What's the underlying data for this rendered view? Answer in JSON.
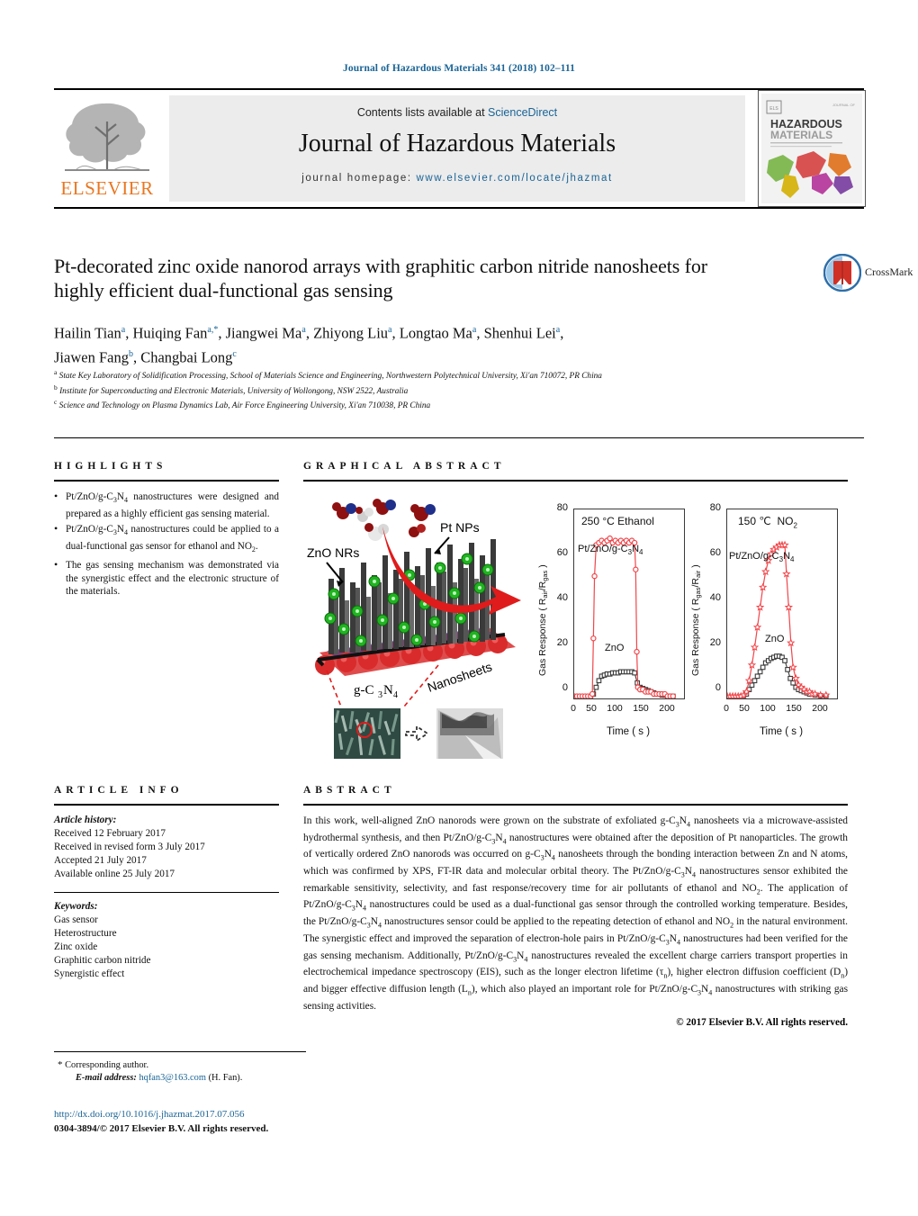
{
  "runhead": "Journal of Hazardous Materials 341 (2018) 102–111",
  "masthead": {
    "contents_prefix": "Contents lists available at ",
    "sciencedirect": "ScienceDirect",
    "journal_title": "Journal of Hazardous Materials",
    "homepage_prefix": "journal homepage: ",
    "homepage_url": "www.elsevier.com/locate/jhazmat",
    "publisher": "ELSEVIER",
    "cover_line1": "HAZARDOUS",
    "cover_line2": "MATERIALS"
  },
  "article": {
    "title": "Pt-decorated zinc oxide nanorod arrays with graphitic carbon nitride nanosheets for highly efficient dual-functional gas sensing",
    "crossmark_label": "CrossMark",
    "authors_line1": "Hailin Tian<sup>a</sup>, Huiqing Fan<sup>a,*</sup>, Jiangwei Ma<sup>a</sup>, Zhiyong Liu<sup>a</sup>, Longtao Ma<sup>a</sup>, Shenhui Lei<sup>a</sup>,",
    "authors_line2": "Jiawen Fang<sup>b</sup>, Changbai Long<sup>c</sup>",
    "affiliations": [
      "<sup>a</sup> State Key Laboratory of Solidification Processing, School of Materials Science and Engineering, Northwestern Polytechnical University, Xi'an 710072, PR China",
      "<sup>b</sup> Institute for Superconducting and Electronic Materials, University of Wollongong, NSW 2522, Australia",
      "<sup>c</sup> Science and Technology on Plasma Dynamics Lab, Air Force Engineering University, Xi'an 710038, PR China"
    ]
  },
  "highlights": {
    "heading": "HIGHLIGHTS",
    "items": [
      "Pt/ZnO/g-C<sub>3</sub>N<sub>4</sub> nanostructures were designed and prepared as a highly efficient gas sensing material.",
      "Pt/ZnO/g-C<sub>3</sub>N<sub>4</sub> nanostructures could be applied to a dual-functional gas sensor for ethanol and NO<sub>2</sub>.",
      "The gas sensing mechanism was demonstrated via the synergistic effect and the electronic structure of the materials."
    ]
  },
  "graphical_abstract": {
    "heading": "GRAPHICAL ABSTRACT",
    "schematic_labels": {
      "znonrs": "ZnO NRs",
      "ptnps": "Pt NPs",
      "nanosheets": "Nanosheets",
      "gc3n4": "g-C₃N₄"
    }
  },
  "article_info": {
    "heading": "ARTICLE INFO",
    "history_label": "Article history:",
    "history": [
      "Received 12 February 2017",
      "Received in revised form 3 July 2017",
      "Accepted 21 July 2017",
      "Available online 25 July 2017"
    ],
    "keywords_label": "Keywords:",
    "keywords": [
      "Gas sensor",
      "Heterostructure",
      "Zinc oxide",
      "Graphitic carbon nitride",
      "Synergistic effect"
    ]
  },
  "abstract": {
    "heading": "ABSTRACT",
    "body": "In this work, well-aligned ZnO nanorods were grown on the substrate of exfoliated g-C<sub>3</sub>N<sub>4</sub> nanosheets via a microwave-assisted hydrothermal synthesis, and then Pt/ZnO/g-C<sub>3</sub>N<sub>4</sub> nanostructures were obtained after the deposition of Pt nanoparticles. The growth of vertically ordered ZnO nanorods was occurred on g-C<sub>3</sub>N<sub>4</sub> nanosheets through the bonding interaction between Zn and N atoms, which was confirmed by XPS, FT-IR data and molecular orbital theory. The Pt/ZnO/g-C<sub>3</sub>N<sub>4</sub> nanostructures sensor exhibited the remarkable sensitivity, selectivity, and fast response/recovery time for air pollutants of ethanol and NO<sub>2</sub>. The application of Pt/ZnO/g-C<sub>3</sub>N<sub>4</sub> nanostructures could be used as a dual-functional gas sensor through the controlled working temperature. Besides, the Pt/ZnO/g-C<sub>3</sub>N<sub>4</sub> nanostructures sensor could be applied to the repeating detection of ethanol and NO<sub>2</sub> in the natural environment. The synergistic effect and improved the separation of electron-hole pairs in Pt/ZnO/g-C<sub>3</sub>N<sub>4</sub> nanostructures had been verified for the gas sensing mechanism. Additionally, Pt/ZnO/g-C<sub>3</sub>N<sub>4</sub> nanostructures revealed the excellent charge carriers transport properties in electrochemical impedance spectroscopy (EIS), such as the longer electron lifetime (&tau;<sub>n</sub>), higher electron diffusion coefficient (D<sub>n</sub>) and bigger effective diffusion length (L<sub>n</sub>), which also played an important role for Pt/ZnO/g-C<sub>3</sub>N<sub>4</sub> nanostructures with striking gas sensing activities.",
    "copyright": "© 2017 Elsevier B.V. All rights reserved."
  },
  "footer": {
    "corresponding_marker": "*",
    "corresponding_text": "Corresponding author.",
    "email_label": "E-mail address:",
    "email": "hqfan3@163.com",
    "email_suffix": "(H. Fan).",
    "doi": "http://dx.doi.org/10.1016/j.jhazmat.2017.07.056",
    "issn_line": "0304-3894/© 2017 Elsevier B.V. All rights reserved."
  },
  "colors": {
    "link": "#1a6496",
    "elsevier_orange": "#E87722",
    "series_red": "#f1464a",
    "series_dark": "#3b3b3b"
  },
  "chart_data": [
    {
      "type": "line",
      "title": "250 °C  Ethanol",
      "xlabel": "Time ( s )",
      "ylabel": "Gas Response ( Rair/Rgas )",
      "xlim": [
        0,
        200
      ],
      "ylim": [
        0,
        85
      ],
      "xticks": [
        0,
        50,
        100,
        150,
        200
      ],
      "yticks": [
        0,
        20,
        40,
        60,
        80
      ],
      "grid": false,
      "annotations": [
        "Pt/ZnO/g-C3N4",
        "ZnO"
      ],
      "series": [
        {
          "name": "Pt/ZnO/g-C3N4",
          "color": "#f1464a",
          "marker": "circle",
          "x": [
            0,
            5,
            10,
            15,
            20,
            25,
            30,
            33,
            35,
            37,
            40,
            45,
            50,
            55,
            60,
            65,
            70,
            75,
            80,
            85,
            90,
            95,
            100,
            105,
            110,
            112,
            114,
            116,
            120,
            125,
            130,
            135,
            140,
            145,
            150,
            155,
            160,
            165,
            170,
            175,
            180
          ],
          "y": [
            1,
            1,
            1,
            1,
            1,
            1,
            1,
            2,
            27,
            55,
            69,
            70,
            71,
            70,
            71,
            72,
            70,
            71,
            70,
            71,
            70,
            71,
            70,
            71,
            70,
            58,
            21,
            5,
            4,
            4,
            3,
            3,
            3,
            2,
            2,
            2,
            2,
            2,
            1,
            1,
            1
          ]
        },
        {
          "name": "ZnO",
          "color": "#3b3b3b",
          "marker": "square",
          "x": [
            0,
            5,
            10,
            15,
            20,
            25,
            30,
            35,
            40,
            45,
            50,
            55,
            60,
            65,
            70,
            75,
            80,
            85,
            90,
            95,
            100,
            105,
            110,
            115,
            120,
            125,
            130,
            135,
            140,
            145,
            150,
            155,
            160,
            165,
            170,
            175,
            180
          ],
          "y": [
            0.5,
            0.5,
            0.5,
            0.5,
            0.5,
            0.5,
            0.7,
            2,
            5,
            8,
            10,
            10.5,
            11,
            11,
            11.5,
            11.5,
            11.5,
            12,
            12,
            12,
            12,
            12,
            11.5,
            7,
            5,
            4.5,
            4,
            3.5,
            3,
            2.5,
            2,
            2,
            1.5,
            1.5,
            1,
            1,
            1
          ]
        }
      ]
    },
    {
      "type": "line",
      "title": "150 °C  NO2",
      "xlabel": "Time ( s )",
      "ylabel": "Gas Response ( Rgas/Rair )",
      "xlim": [
        0,
        200
      ],
      "ylim": [
        0,
        85
      ],
      "xticks": [
        0,
        50,
        100,
        150,
        200
      ],
      "yticks": [
        0,
        20,
        40,
        60,
        80
      ],
      "grid": false,
      "annotations": [
        "Pt/ZnO/g-C3N4",
        "ZnO"
      ],
      "series": [
        {
          "name": "Pt/ZnO/g-C3N4",
          "color": "#f1464a",
          "marker": "star",
          "x": [
            0,
            5,
            10,
            15,
            20,
            25,
            30,
            35,
            40,
            45,
            50,
            55,
            60,
            65,
            70,
            75,
            80,
            85,
            90,
            95,
            100,
            105,
            108,
            112,
            116,
            120,
            125,
            130,
            135,
            140,
            145,
            150,
            155,
            160,
            170,
            180
          ],
          "y": [
            1,
            1,
            1,
            1,
            1,
            1,
            1.5,
            3,
            8,
            15,
            23,
            32,
            41,
            50,
            57,
            62,
            65,
            67,
            68,
            69,
            69,
            69,
            56,
            41,
            25,
            14,
            9,
            6,
            5,
            4,
            3,
            3,
            2,
            2,
            1.5,
            1.5
          ]
        },
        {
          "name": "ZnO",
          "color": "#3b3b3b",
          "marker": "square",
          "x": [
            0,
            5,
            10,
            15,
            20,
            25,
            30,
            35,
            40,
            45,
            50,
            55,
            60,
            65,
            70,
            75,
            80,
            85,
            90,
            95,
            100,
            105,
            110,
            115,
            120,
            125,
            130,
            135,
            140,
            145,
            150,
            160,
            170,
            180
          ],
          "y": [
            0.5,
            0.5,
            0.5,
            0.5,
            0.5,
            0.7,
            1,
            2,
            4,
            6,
            8,
            10,
            12,
            14,
            16,
            17,
            18,
            18.5,
            19,
            19,
            18.5,
            17,
            13,
            9,
            7,
            5,
            4,
            3.5,
            3,
            2.5,
            2,
            1.5,
            1.2,
            1
          ]
        }
      ]
    }
  ]
}
